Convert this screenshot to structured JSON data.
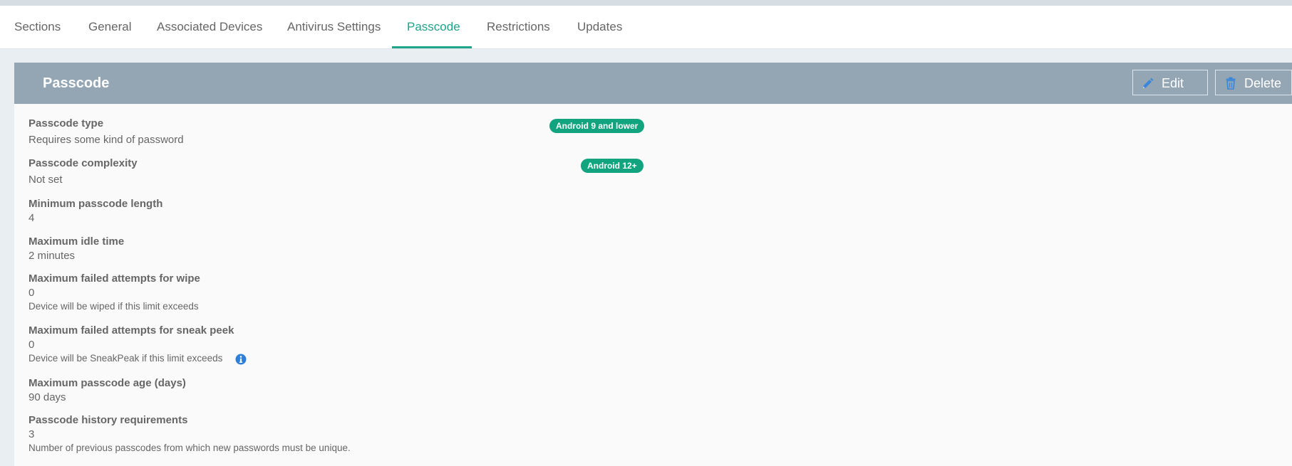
{
  "tabs": [
    {
      "label": "Sections"
    },
    {
      "label": "General"
    },
    {
      "label": "Associated Devices"
    },
    {
      "label": "Antivirus Settings"
    },
    {
      "label": "Passcode"
    },
    {
      "label": "Restrictions"
    },
    {
      "label": "Updates"
    }
  ],
  "active_tab": "Passcode",
  "panel": {
    "title": "Passcode",
    "edit_label": "Edit",
    "delete_label": "Delete"
  },
  "badges": {
    "android9": "Android 9 and lower",
    "android12": "Android 12+"
  },
  "fields": {
    "passcode_type": {
      "label": "Passcode type",
      "value": "Requires some kind of password"
    },
    "passcode_complexity": {
      "label": "Passcode complexity",
      "value": "Not set"
    },
    "min_length": {
      "label": "Minimum passcode length",
      "value": "4"
    },
    "max_idle": {
      "label": "Maximum idle time",
      "value": "2 minutes"
    },
    "max_failed_wipe": {
      "label": "Maximum failed attempts for wipe",
      "value": "0",
      "note": "Device will be wiped if this limit exceeds"
    },
    "max_failed_sneak": {
      "label": "Maximum failed attempts for sneak peek",
      "value": "0",
      "note": "Device will be SneakPeak if this limit exceeds"
    },
    "max_age": {
      "label": "Maximum passcode age (days)",
      "value": "90 days"
    },
    "history": {
      "label": "Passcode history requirements",
      "value": "3",
      "note": "Number of previous passcodes from which new passwords must be unique."
    }
  },
  "colors": {
    "accent": "#1fa38a",
    "badge": "#12a37f",
    "header": "#94a6b4",
    "info_icon": "#2f7fd8"
  },
  "icons": {
    "edit": "pencil-icon",
    "delete": "trash-icon",
    "info": "info-icon"
  }
}
